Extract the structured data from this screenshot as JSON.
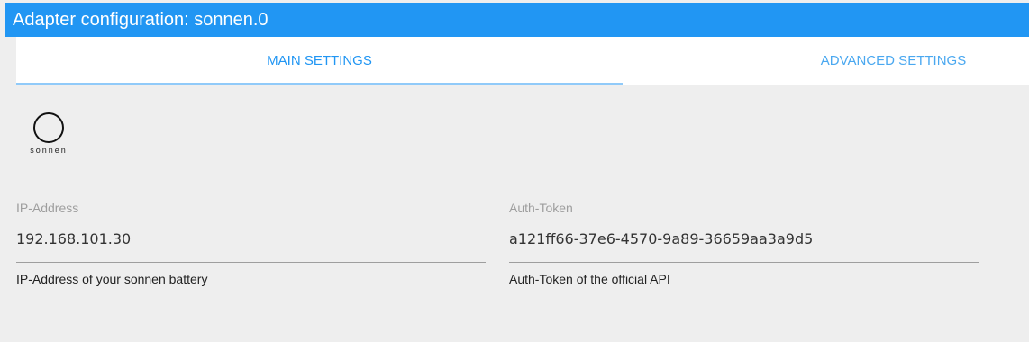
{
  "window": {
    "title": "Adapter configuration: sonnen.0"
  },
  "tabs": [
    {
      "label": "MAIN SETTINGS",
      "active": true
    },
    {
      "label": "ADVANCED SETTINGS",
      "active": false
    }
  ],
  "logo": {
    "icon": "sonnen-logo-icon",
    "text": "sonnen"
  },
  "fields": {
    "ip": {
      "label": "IP-Address",
      "value": "192.168.101.30",
      "helper": "IP-Address of your sonnen battery"
    },
    "token": {
      "label": "Auth-Token",
      "value": "a121ff66-37e6-4570-9a89-36659aa3a9d5",
      "helper": "Auth-Token of the official API"
    }
  },
  "colors": {
    "accent": "#2196f3",
    "background": "#eeeeee"
  }
}
